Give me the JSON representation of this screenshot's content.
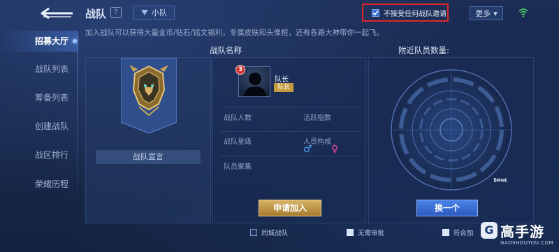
{
  "header": {
    "title": "战队",
    "help_glyph": "?",
    "squad_tab_label": "小队",
    "no_invite_label": "不接受任何战队邀请",
    "no_invite_checked": true,
    "more_label": "更多",
    "more_glyph": "▾"
  },
  "description": "加入战队可以获得大量金币/钻石/铭文福利，专属皮肤和头像框，还有各路大神带你一起飞。",
  "sidebar": {
    "items": [
      {
        "label": "招募大厅",
        "active": true
      },
      {
        "label": "战队列表",
        "active": false
      },
      {
        "label": "筹备列表",
        "active": false
      },
      {
        "label": "创建战队",
        "active": false
      },
      {
        "label": "战区排行",
        "active": false
      },
      {
        "label": "荣耀历程",
        "active": false
      }
    ]
  },
  "team_panel": {
    "header": "战队名称",
    "declaration_label": "战队宣言",
    "leader_level": "3",
    "leader_label": "队长",
    "leader_tag": "队长",
    "fields": {
      "member_count": "战队人数",
      "activity_index": "活跃指数",
      "team_stars": "战队星级",
      "member_makeup": "人员构成",
      "gathering": "队员聚集"
    },
    "male_symbol": "♂",
    "female_symbol": "♀",
    "apply_label": "申请加入"
  },
  "nearby_panel": {
    "header": "附近队员数量:",
    "scale_label": "5Km",
    "swap_label": "换一个"
  },
  "filters": [
    {
      "label": "同城战队",
      "checked": false
    },
    {
      "label": "无需审批",
      "checked": true
    },
    {
      "label": "符合加",
      "checked": true
    }
  ],
  "watermark": {
    "mark": "G",
    "text": "高手游",
    "url": "GAOSHOUYOU.COM"
  },
  "colors": {
    "background": "#16264a",
    "accent_gold": "#c59b3e",
    "accent_blue": "#3b6fd1",
    "highlight_red": "#e0262a"
  }
}
